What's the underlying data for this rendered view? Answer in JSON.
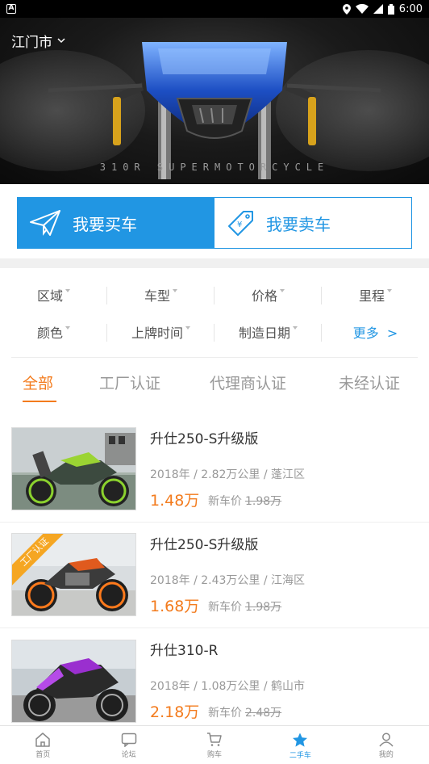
{
  "status_bar": {
    "time": "6:00",
    "left_icon": "A"
  },
  "hero": {
    "city": "江门市",
    "tagline": "310R SUPERMOTORCYCLE"
  },
  "actions": {
    "buy_label": "我要买车",
    "sell_label": "我要卖车"
  },
  "filters": {
    "row1": [
      "区域",
      "车型",
      "价格",
      "里程"
    ],
    "row2": [
      "颜色",
      "上牌时间",
      "制造日期"
    ],
    "more_label": "更多",
    "more_arrow": ">"
  },
  "cert_tabs": [
    "全部",
    "工厂认证",
    "代理商认证",
    "未经认证"
  ],
  "listings": [
    {
      "title": "升仕250-S升级版",
      "meta": "2018年 / 2.82万公里 / 蓬江区",
      "price": "1.48万",
      "new_price_label": "新车价",
      "new_price": "1.98万",
      "badge": ""
    },
    {
      "title": "升仕250-S升级版",
      "meta": "2018年 / 2.43万公里 / 江海区",
      "price": "1.68万",
      "new_price_label": "新车价",
      "new_price": "1.98万",
      "badge": "工厂认证"
    },
    {
      "title": "升仕310-R",
      "meta": "2018年 / 1.08万公里 / 鹤山市",
      "price": "2.18万",
      "new_price_label": "新车价",
      "new_price": "2.48万",
      "badge": ""
    }
  ],
  "bottom_nav": [
    {
      "label": "首页",
      "icon": "home-icon"
    },
    {
      "label": "论坛",
      "icon": "chat-icon"
    },
    {
      "label": "购车",
      "icon": "cart-icon"
    },
    {
      "label": "二手车",
      "icon": "star-icon"
    },
    {
      "label": "我的",
      "icon": "user-icon"
    }
  ],
  "colors": {
    "accent_blue": "#2196e3",
    "accent_orange": "#f37b1d",
    "badge_orange": "#f5a623"
  }
}
